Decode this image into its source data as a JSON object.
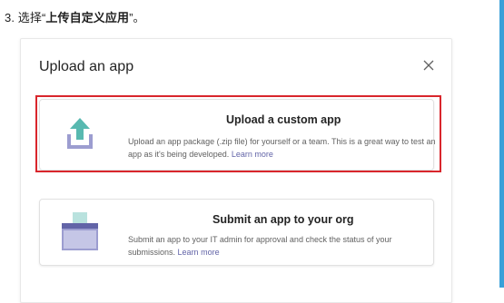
{
  "instruction": {
    "prefix": "3. 选择“",
    "bold": "上传自定义应用",
    "suffix": "”。"
  },
  "dialog": {
    "title": "Upload an app",
    "options": [
      {
        "title": "Upload a custom app",
        "description": "Upload an app package (.zip file) for yourself or a team. This is a great way to test an app as it's being developed.",
        "link": "Learn more",
        "icon": "upload-icon"
      },
      {
        "title": "Submit an app to your org",
        "description": "Submit an app to your IT admin for approval and check the status of your submissions.",
        "link": "Learn more",
        "icon": "submit-to-org-icon"
      }
    ]
  },
  "colors": {
    "highlight": "#d9262c",
    "accent_teal": "#58b9b0",
    "accent_purple": "#9c9dd0",
    "link": "#6264a7",
    "scrollbar": "#3aa0d8"
  }
}
